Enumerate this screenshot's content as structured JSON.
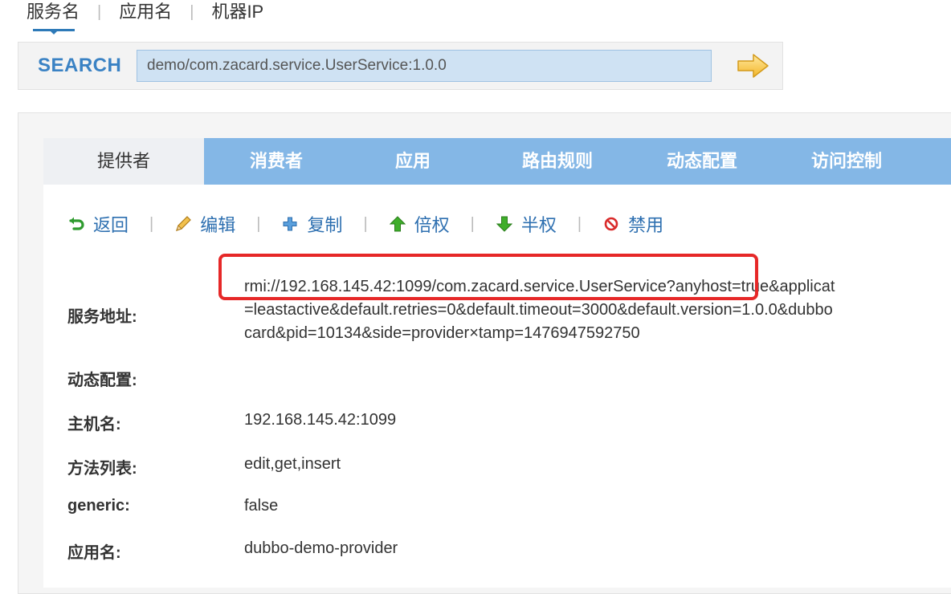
{
  "search_tabs": [
    "服务名",
    "应用名",
    "机器IP"
  ],
  "search": {
    "label": "SEARCH",
    "value": "demo/com.zacard.service.UserService:1.0.0"
  },
  "tabs": [
    "提供者",
    "消费者",
    "应用",
    "路由规则",
    "动态配置",
    "访问控制"
  ],
  "actions": {
    "back": "返回",
    "edit": "编辑",
    "copy": "复制",
    "double": "倍权",
    "half": "半权",
    "disable": "禁用"
  },
  "detail": {
    "service_address_label": "服务地址:",
    "service_address_lines": [
      "rmi://192.168.145.42:1099/com.zacard.service.UserService?anyhost=true&applicat",
      "=leastactive&default.retries=0&default.timeout=3000&default.version=1.0.0&dubbo",
      "card&pid=10134&side=provider×tamp=1476947592750"
    ],
    "dynamic_config_label": "动态配置:",
    "hostname_label": "主机名:",
    "hostname": "192.168.145.42:1099",
    "methods_label": "方法列表:",
    "methods": "edit,get,insert",
    "generic_label": "generic:",
    "generic": "false",
    "app_name_label": "应用名:",
    "app_name": "dubbo-demo-provider"
  },
  "colors": {
    "tab_bar": "#84b7e6",
    "link": "#2d6fb0",
    "highlight": "#e62828"
  }
}
